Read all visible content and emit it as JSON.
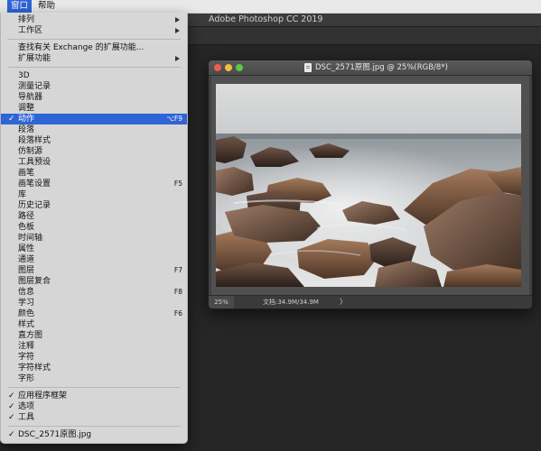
{
  "menubar": {
    "items": [
      {
        "label": "窗口",
        "active": true
      },
      {
        "label": "帮助",
        "active": false
      }
    ]
  },
  "app": {
    "title": "Adobe Photoshop CC 2019"
  },
  "document": {
    "title": "DSC_2571原图.jpg @ 25%(RGB/8*)",
    "zoom": "25%",
    "doc_info": "文档:34.9M/34.9M",
    "info_arrow": "〉"
  },
  "menu": {
    "items": [
      {
        "label": "排列",
        "submenu": true
      },
      {
        "label": "工作区",
        "submenu": true
      },
      {
        "label": "查找有关 Exchange 的扩展功能..."
      },
      {
        "label": "扩展功能",
        "submenu": true
      },
      {
        "label": "3D"
      },
      {
        "label": "测量记录"
      },
      {
        "label": "导航器"
      },
      {
        "label": "调整"
      },
      {
        "label": "动作",
        "checked": true,
        "highlight": true,
        "shortcut": "⌥F9"
      },
      {
        "label": "段落"
      },
      {
        "label": "段落样式"
      },
      {
        "label": "仿制源"
      },
      {
        "label": "工具预设"
      },
      {
        "label": "画笔"
      },
      {
        "label": "画笔设置",
        "shortcut": "F5"
      },
      {
        "label": "库"
      },
      {
        "label": "历史记录"
      },
      {
        "label": "路径"
      },
      {
        "label": "色板"
      },
      {
        "label": "时间轴"
      },
      {
        "label": "属性"
      },
      {
        "label": "通道"
      },
      {
        "label": "图层",
        "shortcut": "F7"
      },
      {
        "label": "图层复合"
      },
      {
        "label": "信息",
        "shortcut": "F8"
      },
      {
        "label": "学习"
      },
      {
        "label": "颜色",
        "shortcut": "F6"
      },
      {
        "label": "样式"
      },
      {
        "label": "直方图"
      },
      {
        "label": "注释"
      },
      {
        "label": "字符"
      },
      {
        "label": "字符样式"
      },
      {
        "label": "字形"
      },
      {
        "label": "应用程序框架",
        "checked": true
      },
      {
        "label": "选项",
        "checked": true
      },
      {
        "label": "工具",
        "checked": true
      },
      {
        "label": "DSC_2571原图.jpg",
        "checked": true
      }
    ],
    "check_glyph": "✓"
  }
}
